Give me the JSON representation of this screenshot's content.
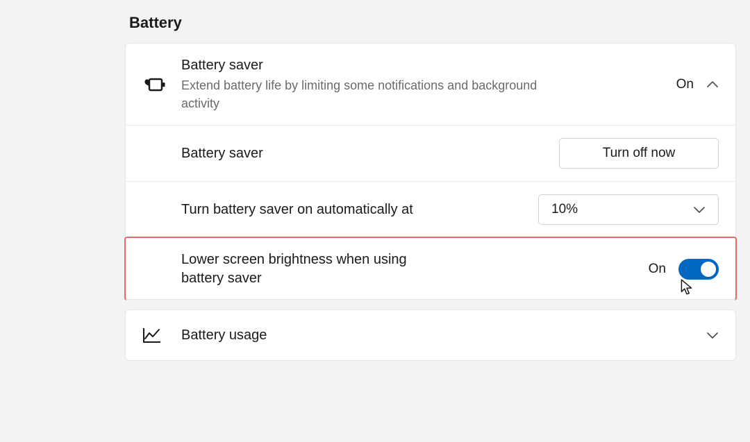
{
  "section": {
    "title": "Battery"
  },
  "battery_saver": {
    "title": "Battery saver",
    "description": "Extend battery life by limiting some notifications and background activity",
    "status": "On",
    "rows": {
      "manual": {
        "label": "Battery saver",
        "button": "Turn off now"
      },
      "auto": {
        "label": "Turn battery saver on automatically at",
        "value": "10%"
      },
      "brightness": {
        "label": "Lower screen brightness when using battery saver",
        "status": "On"
      }
    }
  },
  "battery_usage": {
    "title": "Battery usage"
  },
  "colors": {
    "accent": "#0067c0",
    "highlight": "#e46a67"
  }
}
